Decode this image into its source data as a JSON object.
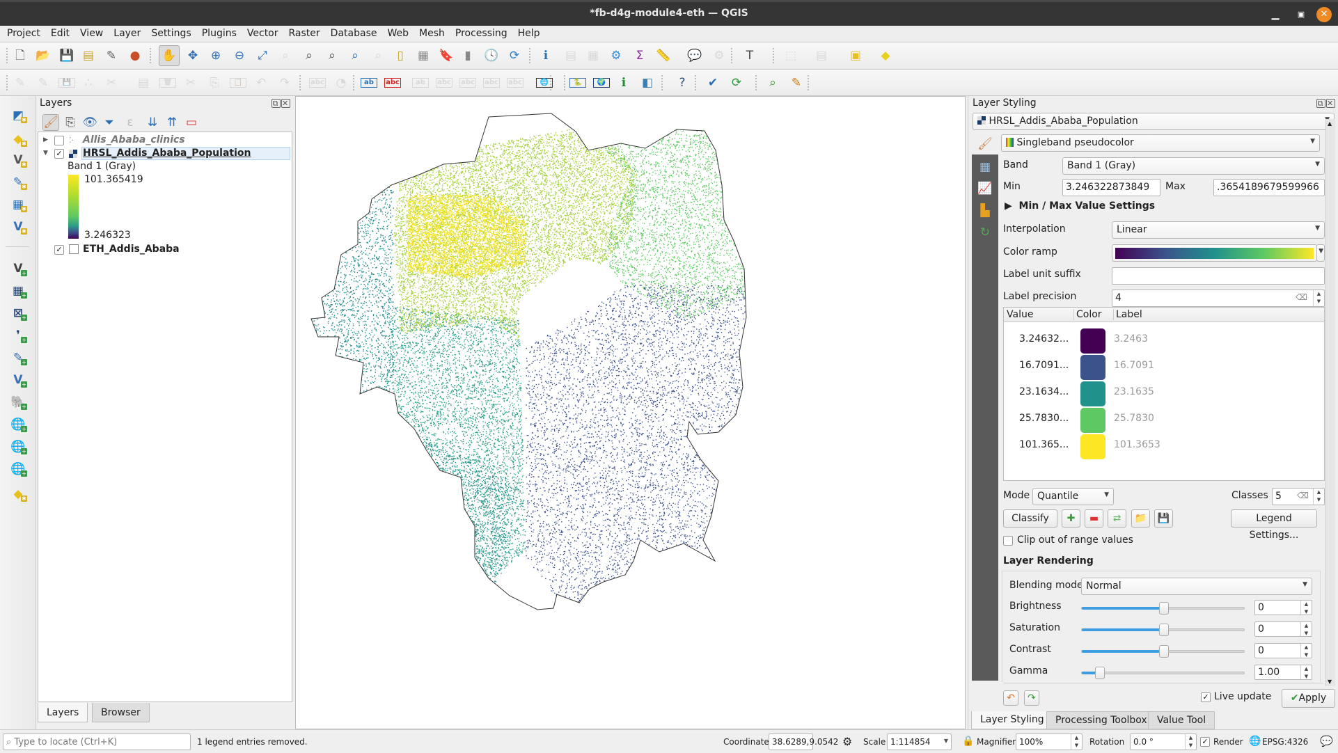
{
  "window": {
    "title": "*fb-d4g-module4-eth — QGIS",
    "minimize_icon": "minimize-icon",
    "maximize_icon": "maximize-icon",
    "close_icon": "close-icon"
  },
  "menu": [
    "Project",
    "Edit",
    "View",
    "Layer",
    "Settings",
    "Plugins",
    "Vector",
    "Raster",
    "Database",
    "Web",
    "Mesh",
    "Processing",
    "Help"
  ],
  "toolbar1": [
    {
      "name": "new-project-icon",
      "glyph": "🗋",
      "color": "#555"
    },
    {
      "name": "open-project-icon",
      "glyph": "📂",
      "color": "#e8b820"
    },
    {
      "name": "save-project-icon",
      "glyph": "💾",
      "color": "#3a5f8a"
    },
    {
      "name": "new-print-layout-icon",
      "glyph": "▤",
      "color": "#c9a21a"
    },
    {
      "name": "layout-manager-icon",
      "glyph": "✎",
      "color": "#666"
    },
    {
      "name": "style-manager-icon",
      "glyph": "●",
      "color": "#c8502a"
    },
    {
      "name": "pan-map-icon",
      "glyph": "✋",
      "color": "#333"
    },
    {
      "name": "pan-to-selection-icon",
      "glyph": "✥",
      "color": "#2a6fb5"
    },
    {
      "name": "zoom-in-icon",
      "glyph": "⊕",
      "color": "#2a6fb5"
    },
    {
      "name": "zoom-out-icon",
      "glyph": "⊖",
      "color": "#2a6fb5"
    },
    {
      "name": "zoom-full-icon",
      "glyph": "⤢",
      "color": "#2a6fb5"
    },
    {
      "name": "zoom-to-selection-icon",
      "glyph": "⌕",
      "color": "#aaa"
    },
    {
      "name": "zoom-to-layer-icon",
      "glyph": "⌕",
      "color": "#555"
    },
    {
      "name": "zoom-native-resolution-icon",
      "glyph": "⌕",
      "color": "#555"
    },
    {
      "name": "zoom-last-icon",
      "glyph": "⌕",
      "color": "#2a6fb5"
    },
    {
      "name": "zoom-next-icon",
      "glyph": "⌕",
      "color": "#aaa"
    },
    {
      "name": "new-map-view-icon",
      "glyph": "▯",
      "color": "#c9a21a"
    },
    {
      "name": "new-3d-map-view-icon",
      "glyph": "▦",
      "color": "#888"
    },
    {
      "name": "new-bookmark-icon",
      "glyph": "🔖",
      "color": "#2a6fb5"
    },
    {
      "name": "show-bookmarks-icon",
      "glyph": "▮",
      "color": "#888"
    },
    {
      "name": "temporal-controller-icon",
      "glyph": "🕓",
      "color": "#666"
    },
    {
      "name": "refresh-icon",
      "glyph": "⟳",
      "color": "#2a7fcc"
    },
    {
      "name": "identify-features-icon",
      "glyph": "ℹ",
      "color": "#2a6fb5"
    },
    {
      "name": "open-attribute-table-icon",
      "glyph": "▤",
      "color": "#aaa"
    },
    {
      "name": "field-calculator-icon",
      "glyph": "▦",
      "color": "#aaa"
    },
    {
      "name": "processing-toolbox-icon",
      "glyph": "⚙",
      "color": "#3a8fd8"
    },
    {
      "name": "statistical-summary-icon",
      "glyph": "Σ",
      "color": "#8a2a9a"
    },
    {
      "name": "measure-line-icon",
      "glyph": "📏",
      "color": "#444"
    },
    {
      "name": "map-tips-icon",
      "glyph": "💬",
      "color": "#e8c820"
    },
    {
      "name": "run-action-icon",
      "glyph": "⚙",
      "color": "#aaa"
    },
    {
      "name": "text-annotation-icon",
      "glyph": "T",
      "color": "#444"
    },
    {
      "name": "select-features-icon",
      "glyph": "⬚",
      "color": "#aaa"
    },
    {
      "name": "deselect-features-icon",
      "glyph": "▤",
      "color": "#aaa"
    },
    {
      "name": "remove-selection-icon",
      "glyph": "▣",
      "color": "#e8c020"
    },
    {
      "name": "create-annotation-icon",
      "glyph": "◆",
      "color": "#e8d020"
    }
  ],
  "toolbar2": [
    {
      "name": "current-edits-icon",
      "glyph": "✎",
      "color": "#aaa"
    },
    {
      "name": "toggle-editing-icon",
      "glyph": "✎",
      "color": "#aaa"
    },
    {
      "name": "save-layer-edits-icon",
      "glyph": "💾",
      "color": "#aaa"
    },
    {
      "name": "add-point-feature-icon",
      "glyph": "∴",
      "color": "#aaa"
    },
    {
      "name": "vertex-tool-icon",
      "glyph": "✂",
      "color": "#aaa"
    },
    {
      "name": "modify-attributes-icon",
      "glyph": "▤",
      "color": "#aaa"
    },
    {
      "name": "delete-selected-icon",
      "glyph": "🗑",
      "color": "#aaa"
    },
    {
      "name": "cut-features-icon",
      "glyph": "✂",
      "color": "#aaa"
    },
    {
      "name": "copy-features-icon",
      "glyph": "⎘",
      "color": "#aaa"
    },
    {
      "name": "paste-features-icon",
      "glyph": "📋",
      "color": "#aaa"
    },
    {
      "name": "undo-icon",
      "glyph": "↶",
      "color": "#aaa"
    },
    {
      "name": "redo-icon",
      "glyph": "↷",
      "color": "#aaa"
    },
    {
      "name": "layer-labeling-icon",
      "glyph": "abc",
      "color": "#aaa"
    },
    {
      "name": "layer-diagram-icon",
      "glyph": "◔",
      "color": "#aaa"
    },
    {
      "name": "pin-labels-icon",
      "glyph": "ab",
      "color": "#2a6fb5"
    },
    {
      "name": "highlight-pinned-labels-icon",
      "glyph": "abc",
      "color": "#d42020"
    },
    {
      "name": "move-label-icon",
      "glyph": "ab",
      "color": "#aaa"
    },
    {
      "name": "show-hide-labels-icon",
      "glyph": "abc",
      "color": "#aaa"
    },
    {
      "name": "rotate-label-icon",
      "glyph": "abc",
      "color": "#aaa"
    },
    {
      "name": "change-label-icon",
      "glyph": "abc",
      "color": "#aaa"
    },
    {
      "name": "edit-label-icon",
      "glyph": "abc",
      "color": "#aaa"
    },
    {
      "name": "osm-search-icon",
      "glyph": "🌐",
      "color": "#333"
    },
    {
      "name": "python-console-icon",
      "glyph": "🐍",
      "color": "#3a6fb0"
    },
    {
      "name": "globe-plugin-icon",
      "glyph": "🌍",
      "color": "#1a3a6a"
    },
    {
      "name": "value-tool-icon",
      "glyph": "ℹ",
      "color": "#1a8a2a"
    },
    {
      "name": "map-swipe-icon",
      "glyph": "◧",
      "color": "#3a7fb5"
    },
    {
      "name": "help-contents-icon",
      "glyph": "?",
      "color": "#2a4a7a"
    },
    {
      "name": "topology-checker-icon",
      "glyph": "✔",
      "color": "#2a6fb5"
    },
    {
      "name": "data-refresh-icon",
      "glyph": "⟳",
      "color": "#2a9a3a"
    },
    {
      "name": "quick-search-icon",
      "glyph": "⌕",
      "color": "#3a9a2a"
    },
    {
      "name": "georeferencer-icon",
      "glyph": "✎",
      "color": "#d08020"
    }
  ],
  "left_toolbar": [
    {
      "name": "data-source-manager-icon",
      "glyph": "◩",
      "color": "#2a6fb5"
    },
    {
      "name": "new-geopackage-layer-icon",
      "glyph": "◆",
      "color": "#e8c020"
    },
    {
      "name": "new-shapefile-layer-icon",
      "glyph": "V",
      "color": "#555"
    },
    {
      "name": "new-temporary-layer-icon",
      "glyph": "✎",
      "color": "#3a6fb0"
    },
    {
      "name": "new-virtual-layer-icon",
      "glyph": "▦",
      "color": "#2a6fb5"
    },
    {
      "name": "new-spatialite-layer-icon",
      "glyph": "V",
      "color": "#3a6fb0"
    },
    {
      "name": "add-vector-layer-icon",
      "glyph": "V",
      "color": "#444"
    },
    {
      "name": "add-raster-layer-icon",
      "glyph": "▦",
      "color": "#2a4a7a"
    },
    {
      "name": "add-mesh-layer-icon",
      "glyph": "⊠",
      "color": "#2a4a7a"
    },
    {
      "name": "add-delimited-text-layer-icon",
      "glyph": "❜",
      "color": "#2a4a7a"
    },
    {
      "name": "add-spatialite-layer-icon",
      "glyph": "✎",
      "color": "#3a6fb0"
    },
    {
      "name": "add-virtual-layer-icon",
      "glyph": "V",
      "color": "#3a6fb0"
    },
    {
      "name": "add-postgis-layer-icon",
      "glyph": "🐘",
      "color": "#2a4a7a"
    },
    {
      "name": "add-wms-layer-icon",
      "glyph": "🌐",
      "color": "#3a6fb0"
    },
    {
      "name": "add-xyz-layer-icon",
      "glyph": "🌐",
      "color": "#1a3a6a"
    },
    {
      "name": "add-wfs-layer-icon",
      "glyph": "🌐",
      "color": "#3a6fb0"
    },
    {
      "name": "new-geopackage-icon",
      "glyph": "◆",
      "color": "#e8c020"
    }
  ],
  "layers_panel": {
    "title": "Layers",
    "tabs": [
      "Layers",
      "Browser"
    ],
    "toolbar": [
      "open-layer-styling-icon",
      "add-group-icon",
      "manage-visibility-icon",
      "filter-legend-icon",
      "filter-expression-icon",
      "expand-all-icon",
      "collapse-all-icon",
      "remove-layer-icon"
    ],
    "layers": [
      {
        "name": "Allis_Ababa_clinics",
        "checked": false,
        "expanded": false
      },
      {
        "name": "HRSL_Addis_Ababa_Population",
        "checked": true,
        "expanded": true,
        "band": "Band 1 (Gray)",
        "max_label": "101.365419",
        "min_label": "3.246323"
      },
      {
        "name": "ETH_Addis_Ababa",
        "checked": true,
        "expanded": false
      }
    ]
  },
  "layer_styling": {
    "title": "Layer Styling",
    "layer": "HRSL_Addis_Ababa_Population",
    "renderer": "Singleband pseudocolor",
    "band_label": "Band",
    "band": "Band 1 (Gray)",
    "min_label": "Min",
    "min": "3.246322873849",
    "max_label": "Max",
    "max": ".3654189679599966",
    "minmax_settings": "Min / Max Value Settings",
    "interpolation_label": "Interpolation",
    "interpolation": "Linear",
    "color_ramp_label": "Color ramp",
    "color_ramp": [
      "#440154",
      "#3b528b",
      "#21918c",
      "#5ec962",
      "#fde725"
    ],
    "label_suffix_label": "Label unit suffix",
    "label_suffix": "",
    "label_precision_label": "Label precision",
    "label_precision": "4",
    "table_headers": [
      "Value",
      "Color",
      "Label"
    ],
    "classes": [
      {
        "value": "3.24632...",
        "color": "#440154",
        "label": "3.2463"
      },
      {
        "value": "16.7091...",
        "color": "#3b528b",
        "label": "16.7091"
      },
      {
        "value": "23.1634...",
        "color": "#21918c",
        "label": "23.1635"
      },
      {
        "value": "25.7830...",
        "color": "#5ec962",
        "label": "25.7830"
      },
      {
        "value": "101.365...",
        "color": "#fde725",
        "label": "101.3653"
      }
    ],
    "mode_label": "Mode",
    "mode": "Quantile",
    "classes_label": "Classes",
    "classes_count": "5",
    "classify": "Classify",
    "legend_settings": "Legend Settings...",
    "clip_label": "Clip out of range values",
    "clip_checked": false,
    "rendering_title": "Layer Rendering",
    "blending_label": "Blending mode",
    "blending": "Normal",
    "sliders": [
      {
        "label": "Brightness",
        "value": "0",
        "fraction": 0.5
      },
      {
        "label": "Saturation",
        "value": "0",
        "fraction": 0.5
      },
      {
        "label": "Contrast",
        "value": "0",
        "fraction": 0.5
      },
      {
        "label": "Gamma",
        "value": "1.00",
        "fraction": 0.11
      }
    ],
    "live_update": "Live update",
    "live_update_checked": true,
    "apply": "Apply",
    "tabs": [
      "Layer Styling",
      "Processing Toolbox",
      "Value Tool"
    ]
  },
  "status": {
    "locator_placeholder": "Type to locate (Ctrl+K)",
    "message": "1 legend entries removed.",
    "coordinate_label": "Coordinate",
    "coordinate": "38.6289,9.0542",
    "scale_label": "Scale",
    "scale": "1:114854",
    "magnifier_label": "Magnifier",
    "magnifier": "100%",
    "rotation_label": "Rotation",
    "rotation": "0.0 °",
    "render_label": "Render",
    "render_checked": true,
    "crs": "EPSG:4326"
  },
  "map": {
    "class_colors": [
      "#440154",
      "#3b528b",
      "#21918c",
      "#5ec962",
      "#fde725"
    ],
    "zone_colors": {
      "northwest_teal": "#1f8a8a",
      "central_yellow": "#f2e21f",
      "center_lime": "#a6d13f",
      "northeast_green": "#5ec962",
      "east_navy": "#3b4f8c",
      "southwest_teal": "#2a9d87",
      "outline": "#333333"
    }
  }
}
